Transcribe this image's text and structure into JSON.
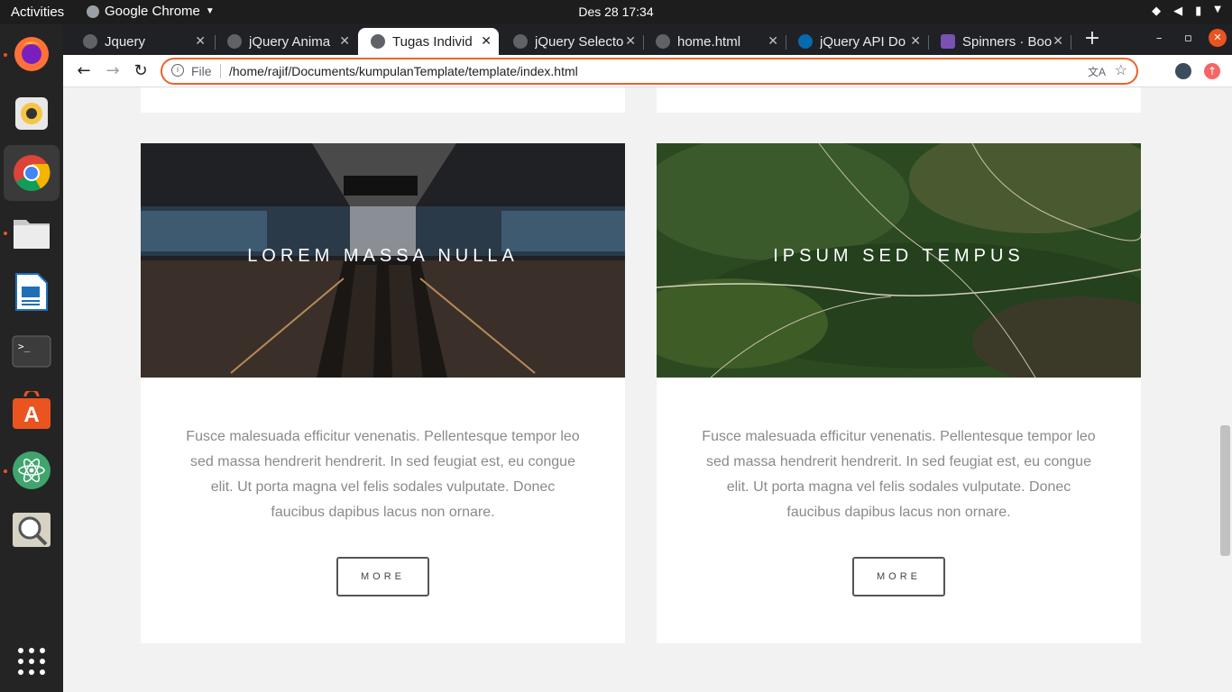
{
  "system_bar": {
    "activities": "Activities",
    "app_name": "Google Chrome",
    "clock": "Des 28  17:34"
  },
  "browser": {
    "tabs": [
      {
        "title": "Jquery",
        "active": false
      },
      {
        "title": "jQuery Anima",
        "active": false
      },
      {
        "title": "Tugas Individ",
        "active": true
      },
      {
        "title": "jQuery Selecto",
        "active": false
      },
      {
        "title": "home.html",
        "active": false
      },
      {
        "title": "jQuery API Do",
        "active": false
      },
      {
        "title": "Spinners · Boo",
        "active": false
      }
    ],
    "address": {
      "scheme": "File",
      "url": "/home/rajif/Documents/kumpulanTemplate/template/index.html"
    }
  },
  "page": {
    "cards": [
      {
        "title": "LOREM MASSA NULLA",
        "text": "Fusce malesuada efficitur venenatis. Pellentesque tempor leo sed massa hendrerit hendrerit. In sed feugiat est, eu congue elit. Ut porta magna vel felis sodales vulputate. Donec faucibus dapibus lacus non ornare.",
        "button": "MORE",
        "image": "train-station-escalator"
      },
      {
        "title": "IPSUM SED TEMPUS",
        "text": "Fusce malesuada efficitur venenatis. Pellentesque tempor leo sed massa hendrerit hendrerit. In sed feugiat est, eu congue elit. Ut porta magna vel felis sodales vulputate. Donec faucibus dapibus lacus non ornare.",
        "button": "MORE",
        "image": "aerial-green-hills"
      }
    ]
  },
  "colors": {
    "accent_outline": "#e8632b",
    "dock_indicator": "#e95420"
  }
}
